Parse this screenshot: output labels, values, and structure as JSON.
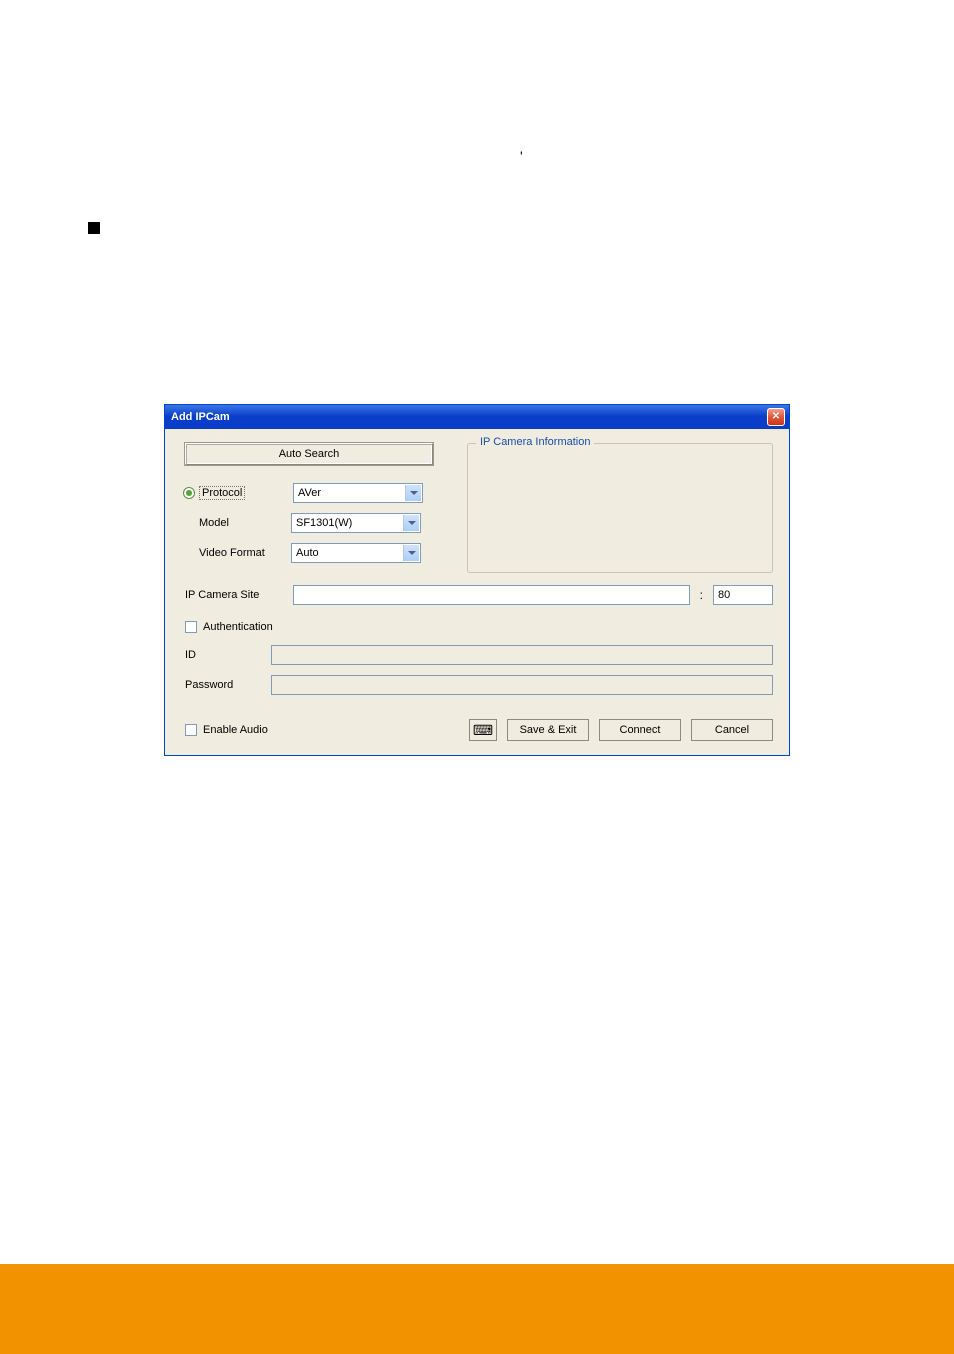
{
  "dialog": {
    "title": "Add IPCam",
    "autoSearch": "Auto Search",
    "protocolLabel": "Protocol",
    "protocolValue": "AVer",
    "modelLabel": "Model",
    "modelValue": "SF1301(W)",
    "videoFormatLabel": "Video Format",
    "videoFormatValue": "Auto",
    "groupTitle": "IP Camera Information",
    "siteLabel": "IP Camera Site",
    "siteValue": "",
    "portValue": "80",
    "authenticationLabel": "Authentication",
    "idLabel": "ID",
    "idValue": "",
    "passwordLabel": "Password",
    "passwordValue": "",
    "enableAudioLabel": "Enable Audio",
    "saveExit": "Save & Exit",
    "connect": "Connect",
    "cancel": "Cancel"
  }
}
